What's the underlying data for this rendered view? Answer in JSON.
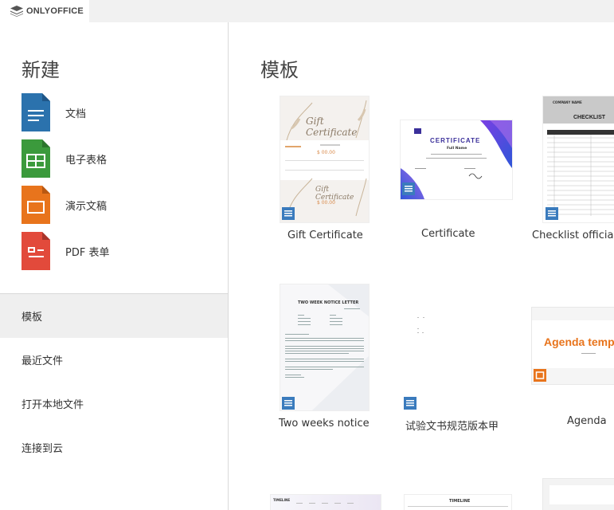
{
  "app": {
    "brand": "ONLYOFFICE"
  },
  "sidebar": {
    "new_title": "新建",
    "create": [
      {
        "label": "文档",
        "color": "#2b72ad"
      },
      {
        "label": "电子表格",
        "color": "#3b9a3c"
      },
      {
        "label": "演示文稿",
        "color": "#e8741c"
      },
      {
        "label": "PDF 表单",
        "color": "#e24a3b"
      }
    ],
    "nav": [
      {
        "label": "模板",
        "active": true
      },
      {
        "label": "最近文件"
      },
      {
        "label": "打开本地文件"
      },
      {
        "label": "连接到云"
      }
    ]
  },
  "main": {
    "title": "模板",
    "templates": [
      {
        "label": "Gift Certificate",
        "type": "document",
        "thumb": {
          "heading": "Gift Certificate",
          "amount": "$ 00.00"
        }
      },
      {
        "label": "Certificate",
        "type": "document",
        "thumb": {
          "heading": "CERTIFICATE",
          "name": "Full Name"
        }
      },
      {
        "label": "Checklist official",
        "type": "document",
        "thumb": {
          "heading": "CHECKLIST",
          "company": "COMPANY NAME"
        }
      },
      {
        "label": "Two weeks notice",
        "type": "document",
        "thumb": {
          "heading": "TWO WEEK NOTICE LETTER"
        }
      },
      {
        "label": "试验文书规范版本甲",
        "type": "document"
      },
      {
        "label": "Agenda",
        "type": "presentation",
        "thumb": {
          "heading": "Agenda templ"
        }
      }
    ],
    "row3": {
      "timeline_a": "TIMELINE",
      "timeline_b": "TIMELINE"
    }
  },
  "colors": {
    "doc_badge": "#3a7bbd",
    "slide_badge": "#e8741c",
    "agenda_orange": "#e8741c"
  }
}
